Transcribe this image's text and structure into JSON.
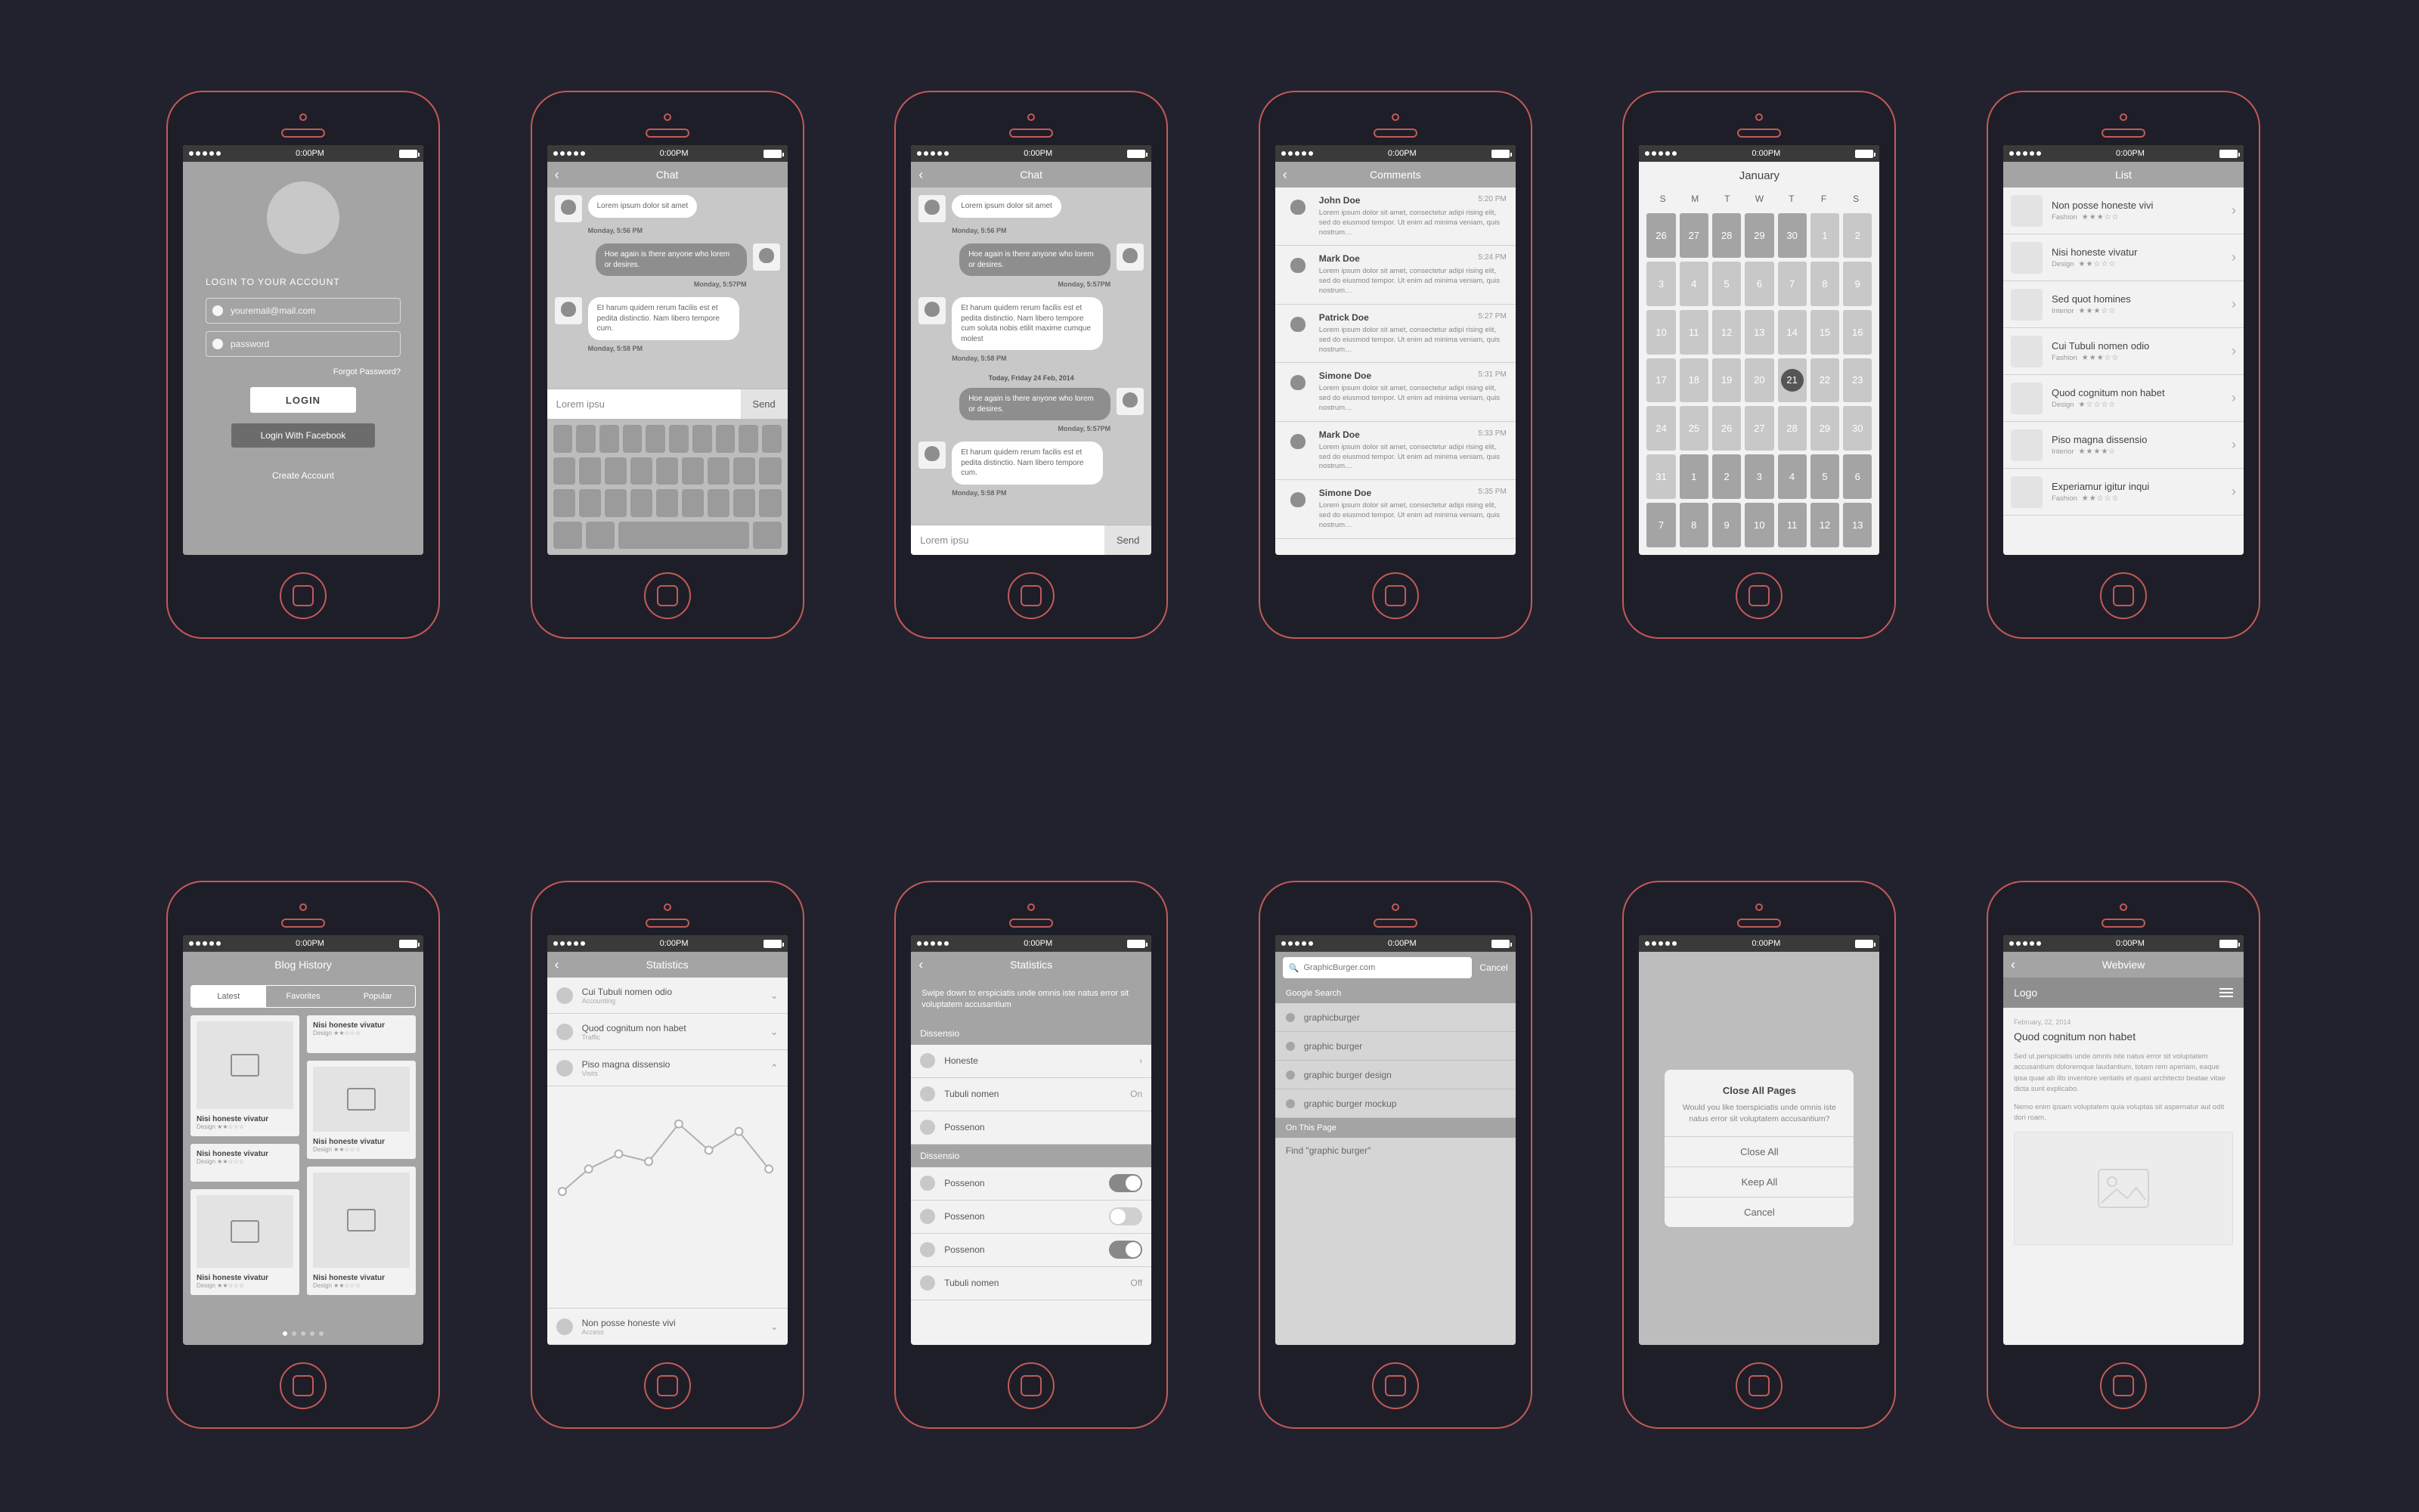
{
  "status": {
    "time": "0:00PM"
  },
  "login": {
    "heading": "LOGIN TO YOUR ACCOUNT",
    "email_placeholder": "youremail@mail.com",
    "password_placeholder": "password",
    "forgot": "Forgot Password?",
    "login_btn": "LOGIN",
    "fb_btn": "Login With Facebook",
    "create": "Create Account"
  },
  "chat": {
    "title": "Chat",
    "msg1": "Lorem ipsum dolor sit amet",
    "stamp1": "Monday, 5:56 PM",
    "msg2": "Hoe again is there anyone who lorem or desires.",
    "stamp2": "Monday, 5:57PM",
    "msg3": "Et harum quidem rerum facilis est et pedita distinctio. Nam libero tempore cum.",
    "stamp3": "Monday, 5:58 PM",
    "input_placeholder": "Lorem ipsu",
    "send": "Send",
    "day": "Today, Friday 24 Feb, 2014",
    "msg4": "Hoe again is there anyone who lorem or desires.",
    "stamp4": "Monday, 5:57PM",
    "msg5": "Et harum quidem rerum facilis est et pedita distinctio. Nam libero tempore cum soluta nobis etilit maxime cumque molest",
    "stamp5": "Monday, 5:58 PM"
  },
  "comments": {
    "title": "Comments",
    "text": "Lorem ipsum dolor sit amet, consectetur adipi rising elit, sed do eiusmod tempor. Ut enim ad minima veniam, quis nostrum…",
    "items": [
      {
        "name": "John Doe",
        "time": "5:20 PM"
      },
      {
        "name": "Mark Doe",
        "time": "5:24 PM"
      },
      {
        "name": "Patrick Doe",
        "time": "5:27 PM"
      },
      {
        "name": "Simone Doe",
        "time": "5:31 PM"
      },
      {
        "name": "Mark Doe",
        "time": "5:33 PM"
      },
      {
        "name": "Simone Doe",
        "time": "5:35 PM"
      }
    ]
  },
  "calendar": {
    "month": "January",
    "dow": [
      "S",
      "M",
      "T",
      "W",
      "T",
      "F",
      "S"
    ],
    "days": [
      {
        "n": "26",
        "dim": true
      },
      {
        "n": "27",
        "dim": true
      },
      {
        "n": "28",
        "dim": true
      },
      {
        "n": "29",
        "dim": true
      },
      {
        "n": "30",
        "dim": true
      },
      {
        "n": "1",
        "dim": false
      },
      {
        "n": "2",
        "dim": false
      },
      {
        "n": "3",
        "dim": false
      },
      {
        "n": "4",
        "dim": false
      },
      {
        "n": "5",
        "dim": false
      },
      {
        "n": "6",
        "dim": false
      },
      {
        "n": "7",
        "dim": false
      },
      {
        "n": "8",
        "dim": false
      },
      {
        "n": "9",
        "dim": false
      },
      {
        "n": "10",
        "dim": false
      },
      {
        "n": "11",
        "dim": false
      },
      {
        "n": "12",
        "dim": false
      },
      {
        "n": "13",
        "dim": false
      },
      {
        "n": "14",
        "dim": false
      },
      {
        "n": "15",
        "dim": false
      },
      {
        "n": "16",
        "dim": false
      },
      {
        "n": "17",
        "dim": false
      },
      {
        "n": "18",
        "dim": false
      },
      {
        "n": "19",
        "dim": false
      },
      {
        "n": "20",
        "dim": false
      },
      {
        "n": "21",
        "dim": false,
        "today": true
      },
      {
        "n": "22",
        "dim": false
      },
      {
        "n": "23",
        "dim": false
      },
      {
        "n": "24",
        "dim": false
      },
      {
        "n": "25",
        "dim": false
      },
      {
        "n": "26",
        "dim": false
      },
      {
        "n": "27",
        "dim": false
      },
      {
        "n": "28",
        "dim": false
      },
      {
        "n": "29",
        "dim": false
      },
      {
        "n": "30",
        "dim": false
      },
      {
        "n": "31",
        "dim": false
      },
      {
        "n": "1",
        "dim": true
      },
      {
        "n": "2",
        "dim": true
      },
      {
        "n": "3",
        "dim": true
      },
      {
        "n": "4",
        "dim": true
      },
      {
        "n": "5",
        "dim": true
      },
      {
        "n": "6",
        "dim": true
      },
      {
        "n": "7",
        "dim": true
      },
      {
        "n": "8",
        "dim": true
      },
      {
        "n": "9",
        "dim": true
      },
      {
        "n": "10",
        "dim": true
      },
      {
        "n": "11",
        "dim": true
      },
      {
        "n": "12",
        "dim": true
      },
      {
        "n": "13",
        "dim": true
      }
    ]
  },
  "list": {
    "title": "List",
    "items": [
      {
        "title": "Non posse honeste vivi",
        "cat": "Fashion",
        "stars": "★★★☆☆"
      },
      {
        "title": "Nisi honeste vivatur",
        "cat": "Design",
        "stars": "★★☆☆☆"
      },
      {
        "title": "Sed quot homines",
        "cat": "Interior",
        "stars": "★★★☆☆"
      },
      {
        "title": "Cui Tubuli nomen odio",
        "cat": "Fashion",
        "stars": "★★★☆☆"
      },
      {
        "title": "Quod cognitum non habet",
        "cat": "Design",
        "stars": "★☆☆☆☆"
      },
      {
        "title": "Piso magna dissensio",
        "cat": "Interior",
        "stars": "★★★★☆"
      },
      {
        "title": "Experiamur igitur inqui",
        "cat": "Fashion",
        "stars": "★★☆☆☆"
      }
    ]
  },
  "blog": {
    "title": "Blog History",
    "tabs": [
      "Latest",
      "Favorites",
      "Popular"
    ],
    "card_title": "Nisi honeste vivatur",
    "card_cat": "Design",
    "card_stars": "★★☆☆☆"
  },
  "stats": {
    "title": "Statistics",
    "items": [
      {
        "t": "Cui Tubuli nomen odio",
        "s": "Accounting"
      },
      {
        "t": "Quod cognitum non habet",
        "s": "Traffic"
      },
      {
        "t": "Piso magna dissensio",
        "s": "Visits"
      },
      {
        "t": "Non posse honeste vivi",
        "s": "Access"
      }
    ]
  },
  "settings": {
    "title": "Statistics",
    "instr": "Swipe down to erspiciatis unde omnis iste natus error sit voluptatem accusantium",
    "sect1": "Dissensio",
    "r1": "Honeste",
    "r2": "Tubuli nomen",
    "r2v": "On",
    "r3": "Possenon",
    "sect2": "Dissensio",
    "t1": "Possenon",
    "t2": "Possenon",
    "t3": "Possenon",
    "r4": "Tubuli nomen",
    "r4v": "Off"
  },
  "search": {
    "query": "GraphicBurger.com",
    "cancel": "Cancel",
    "sect1": "Google Search",
    "s1": "graphicburger",
    "s2": "graphic burger",
    "s3": "graphic burger design",
    "s4": "graphic burger mockup",
    "sect2": "On This Page",
    "find": "Find \"graphic burger\""
  },
  "alert": {
    "title": "Close All Pages",
    "body": "Would you like toerspiciatis unde omnis iste natus error sit voluptatem accusantium?",
    "o1": "Close All",
    "o2": "Keep All",
    "o3": "Cancel"
  },
  "webview": {
    "title": "Webview",
    "logo": "Logo",
    "date": "February, 22, 2014",
    "heading": "Quod cognitum non habet",
    "p1": "Sed ut perspiciatis unde omnis iste natus error sit voluptatem accusantium doloremque laudantium, totam rem aperiam, eaque ipsa quae ab illo inventore veritatis et quasi architecto beatae vitae dicta sunt explicabo.",
    "p2": "Nemo enim ipsam voluptatem quia voluptas sit aspernatur aut odit dori roam."
  }
}
